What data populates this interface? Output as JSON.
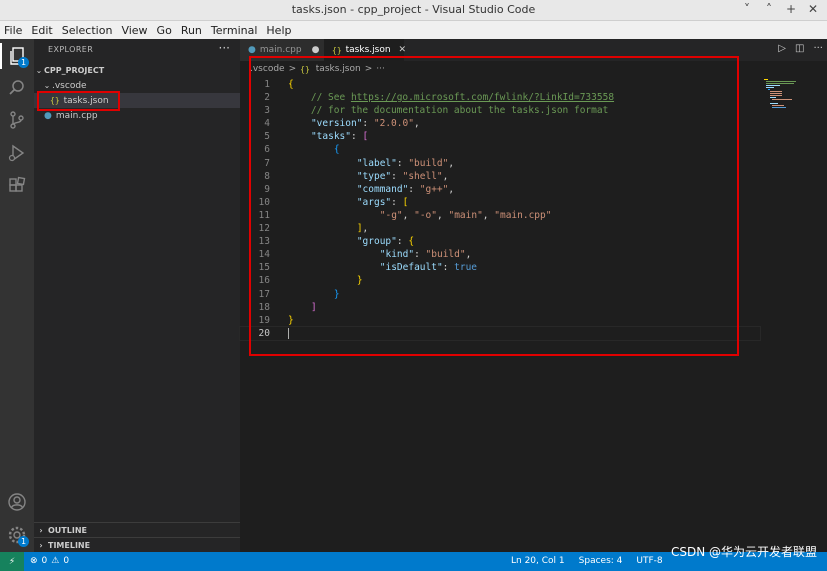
{
  "window": {
    "title": "tasks.json - cpp_project - Visual Studio Code",
    "controls": [
      "˅",
      "˄",
      "+",
      "✕"
    ]
  },
  "menu": [
    "File",
    "Edit",
    "Selection",
    "View",
    "Go",
    "Run",
    "Terminal",
    "Help"
  ],
  "activity": {
    "explorer_badge": "1",
    "settings_badge": "1"
  },
  "sidebar": {
    "header": "EXPLORER",
    "more": "···",
    "project": "CPP_PROJECT",
    "tree": [
      {
        "label": ".vscode",
        "kind": "folder"
      },
      {
        "label": "tasks.json",
        "kind": "json"
      },
      {
        "label": "main.cpp",
        "kind": "cpp"
      }
    ],
    "outline": "OUTLINE",
    "timeline": "TIMELINE"
  },
  "tabs": [
    {
      "label": "main.cpp",
      "state": "modified"
    },
    {
      "label": "tasks.json",
      "state": "active"
    }
  ],
  "breadcrumb": {
    "folder": ".vscode",
    "sep": ">",
    "file": "tasks.json",
    "more": "···"
  },
  "code": {
    "current_line": 20,
    "lines": [
      "{",
      "    // See https://go.microsoft.com/fwlink/?LinkId=733558",
      "    // for the documentation about the tasks.json format",
      "    \"version\": \"2.0.0\",",
      "    \"tasks\": [",
      "        {",
      "            \"label\": \"build\",",
      "            \"type\": \"shell\",",
      "            \"command\": \"g++\",",
      "            \"args\": [",
      "                \"-g\", \"-o\", \"main\", \"main.cpp\"",
      "            ],",
      "            \"group\": {",
      "                \"kind\": \"build\",",
      "                \"isDefault\": true",
      "            }",
      "        }",
      "    ]",
      "}",
      ""
    ]
  },
  "statusbar": {
    "remote": "⚡",
    "errors": "0",
    "warnings": "0",
    "position": "Ln 20, Col 1",
    "spaces": "Spaces: 4",
    "encoding": "UTF-8"
  },
  "watermark": "CSDN @华为云开发者联盟",
  "colors": {
    "accent": "#007acc",
    "remote": "#16825d",
    "highlight_box": "#e00000"
  }
}
